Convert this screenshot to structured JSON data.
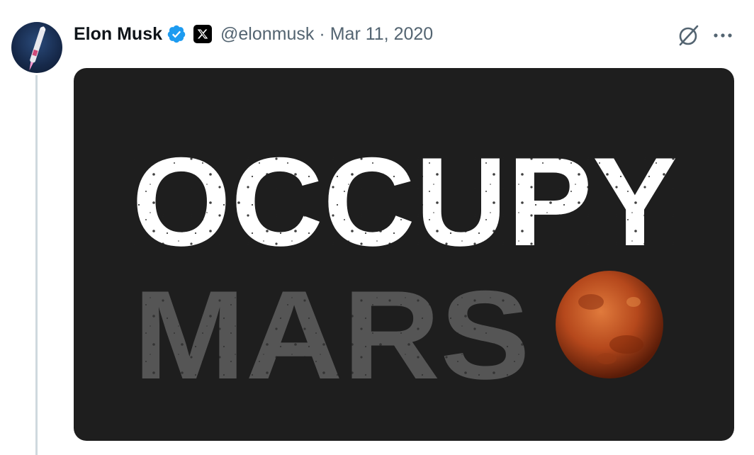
{
  "tweet": {
    "author_name": "Elon Musk",
    "handle": "@elonmusk",
    "separator": "·",
    "date": "Mar 11, 2020",
    "verified_icon": "verified-badge-icon",
    "affiliate_icon": "x-logo-icon",
    "grok_icon": "grok-icon",
    "more_icon": "more-icon"
  },
  "media": {
    "line1": "OCCUPY",
    "line2": "MARS",
    "colors": {
      "background": "#1e1e1e",
      "line1": "#ffffff",
      "line2": "#555555",
      "planet": "#b5481c"
    }
  },
  "colors": {
    "name": "#0f1419",
    "secondary": "#536471",
    "verified": "#1d9bf0",
    "thread_line": "#cfd9de"
  }
}
